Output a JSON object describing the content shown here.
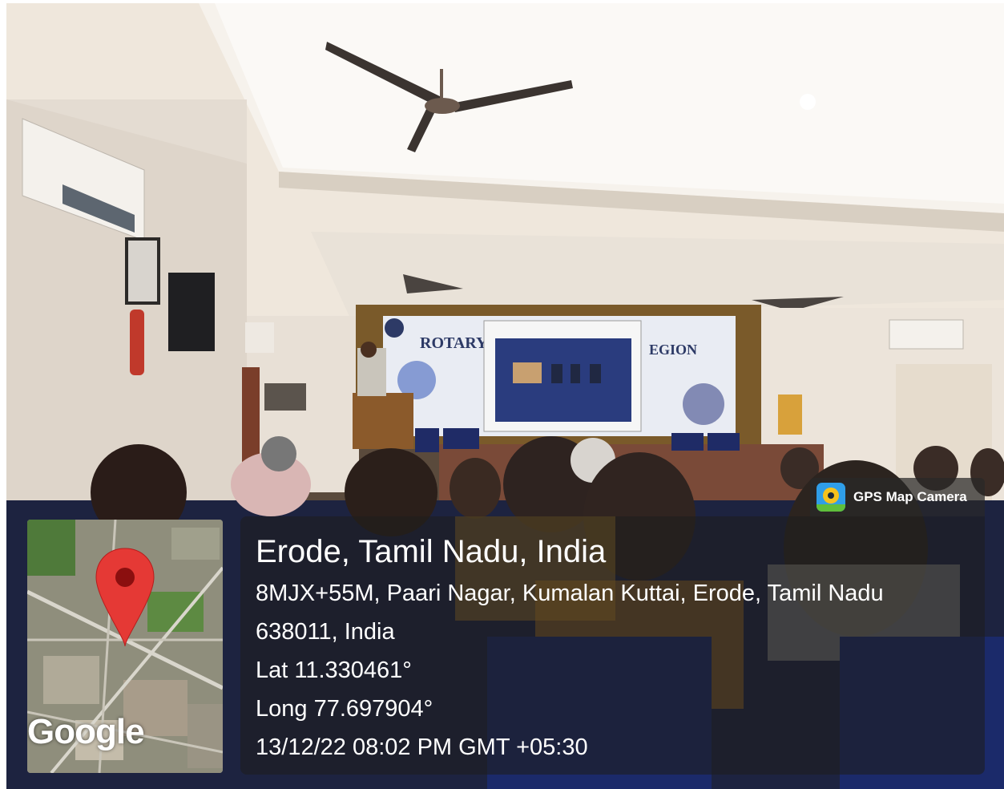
{
  "photo": {
    "banner_word_left": "ROTARY",
    "banner_word_right": "EGION"
  },
  "badge": {
    "icon": "gps-map-camera-icon",
    "label": "GPS Map Camera"
  },
  "map": {
    "brand": "Google",
    "pin_icon": "location-pin-icon",
    "pin_color": "#e53935"
  },
  "location": {
    "title": "Erode, Tamil Nadu, India",
    "address_line1": "8MJX+55M, Paari Nagar, Kumalan Kuttai, Erode, Tamil Nadu",
    "address_line2": "638011, India",
    "lat": "Lat 11.330461°",
    "long": "Long 77.697904°",
    "datetime": "13/12/22 08:02 PM GMT +05:30"
  }
}
